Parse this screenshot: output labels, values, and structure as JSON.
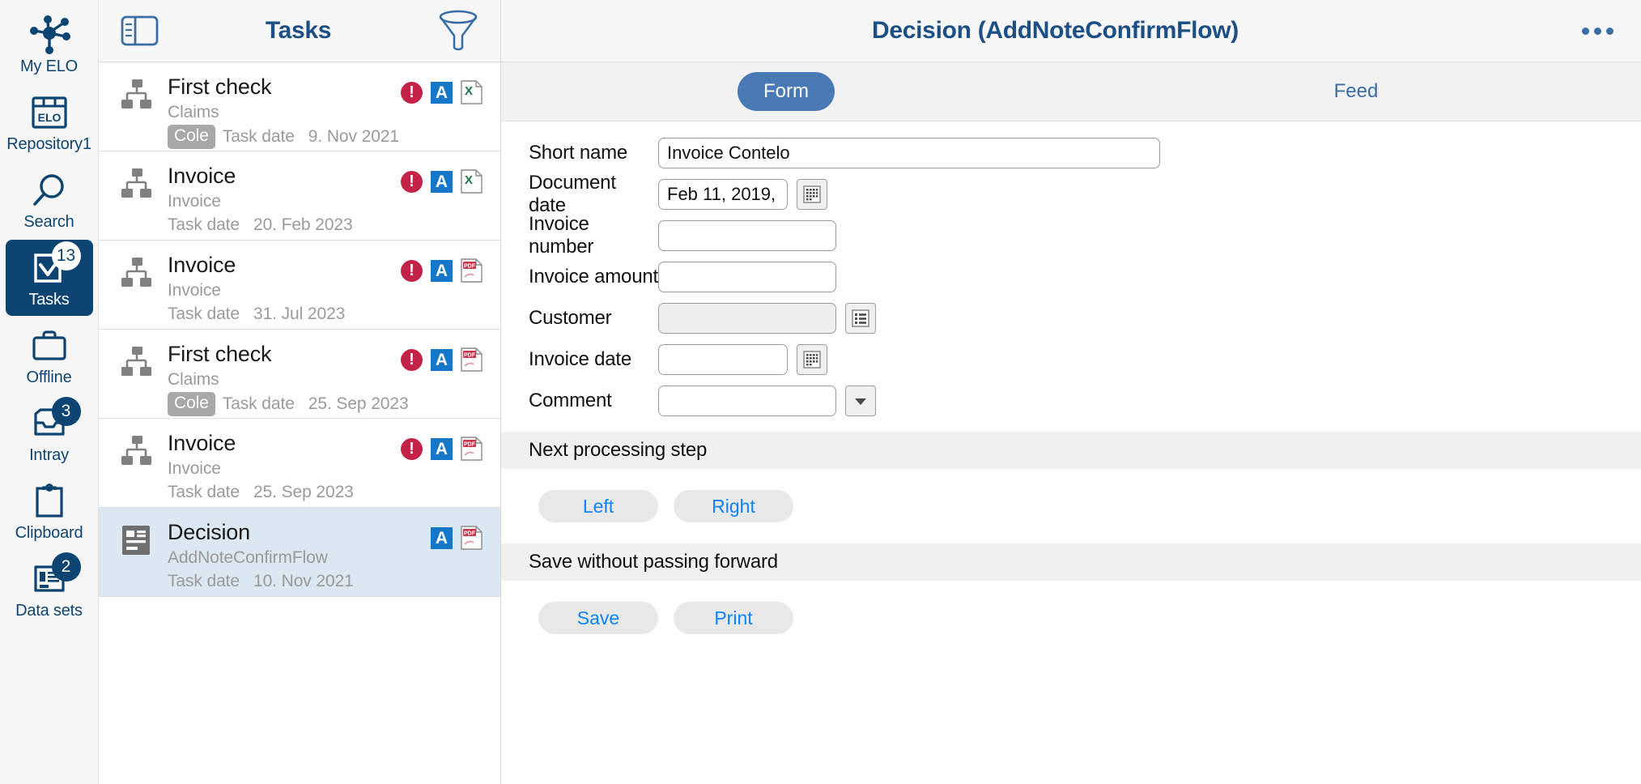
{
  "rail": {
    "items": [
      {
        "label": "My ELO",
        "icon": "network-hub-icon",
        "badge": null,
        "active": false
      },
      {
        "label": "Repository1",
        "icon": "repository-icon",
        "badge": null,
        "active": false
      },
      {
        "label": "Search",
        "icon": "search-icon",
        "badge": null,
        "active": false
      },
      {
        "label": "Tasks",
        "icon": "tasks-check-icon",
        "badge": "13",
        "active": true
      },
      {
        "label": "Offline",
        "icon": "briefcase-icon",
        "badge": null,
        "active": false
      },
      {
        "label": "Intray",
        "icon": "intray-icon",
        "badge": "3",
        "active": false
      },
      {
        "label": "Clipboard",
        "icon": "clipboard-icon",
        "badge": null,
        "active": false
      },
      {
        "label": "Data sets",
        "icon": "data-sets-icon",
        "badge": "2",
        "active": false
      }
    ]
  },
  "tasklist": {
    "title": "Tasks",
    "panel_toggle_icon": "panel-toggle-icon",
    "filter_icon": "filter-funnel-icon",
    "rows": [
      {
        "name": "First check",
        "subtitle": "Claims",
        "chip": "Cole",
        "date_label": "Task date",
        "date_value": "9. Nov 2021",
        "type_icon": "workflow-icon",
        "selected": false,
        "status_icons": [
          "alert-icon",
          "annotation-a-icon",
          "excel-file-icon"
        ]
      },
      {
        "name": "Invoice",
        "subtitle": "Invoice",
        "chip": null,
        "date_label": "Task date",
        "date_value": "20. Feb 2023",
        "type_icon": "workflow-icon",
        "selected": false,
        "status_icons": [
          "alert-icon",
          "annotation-a-icon",
          "excel-file-icon"
        ]
      },
      {
        "name": "Invoice",
        "subtitle": "Invoice",
        "chip": null,
        "date_label": "Task date",
        "date_value": "31. Jul 2023",
        "type_icon": "workflow-icon",
        "selected": false,
        "status_icons": [
          "alert-icon",
          "annotation-a-icon",
          "pdf-file-icon"
        ]
      },
      {
        "name": "First check",
        "subtitle": "Claims",
        "chip": "Cole",
        "date_label": "Task date",
        "date_value": "25. Sep 2023",
        "type_icon": "workflow-icon",
        "selected": false,
        "status_icons": [
          "alert-icon",
          "annotation-a-icon",
          "pdf-file-icon"
        ]
      },
      {
        "name": "Invoice",
        "subtitle": "Invoice",
        "chip": null,
        "date_label": "Task date",
        "date_value": "25. Sep 2023",
        "type_icon": "workflow-icon",
        "selected": false,
        "status_icons": [
          "alert-icon",
          "annotation-a-icon",
          "pdf-file-icon"
        ]
      },
      {
        "name": "Decision",
        "subtitle": "AddNoteConfirmFlow",
        "chip": null,
        "date_label": "Task date",
        "date_value": "10. Nov 2021",
        "type_icon": "form-icon",
        "selected": true,
        "status_icons": [
          "annotation-a-icon",
          "pdf-file-icon"
        ]
      }
    ]
  },
  "detail": {
    "title": "Decision (AddNoteConfirmFlow)",
    "overflow_icon": "more-options-icon",
    "tabs": [
      {
        "label": "Form",
        "active": true
      },
      {
        "label": "Feed",
        "active": false
      }
    ],
    "form_fields": [
      {
        "label": "Short name",
        "value": "Invoice Contelo",
        "width": "wide",
        "disabled": false,
        "button": null
      },
      {
        "label": "Document date",
        "value": "Feb 11, 2019, ",
        "width": "short",
        "disabled": false,
        "button": "calendar-icon"
      },
      {
        "label": "Invoice number",
        "value": "",
        "width": "med",
        "disabled": false,
        "button": null
      },
      {
        "label": "Invoice amount",
        "value": "",
        "width": "med",
        "disabled": false,
        "button": null
      },
      {
        "label": "Customer",
        "value": "",
        "width": "med",
        "disabled": true,
        "button": "list-picker-icon"
      },
      {
        "label": "Invoice date",
        "value": "",
        "width": "short",
        "disabled": false,
        "button": "calendar-icon"
      },
      {
        "label": "Comment",
        "value": "",
        "width": "med",
        "disabled": false,
        "button": "chevron-down-icon"
      }
    ],
    "sections": [
      {
        "heading": "Next processing step",
        "buttons": [
          "Left",
          "Right"
        ]
      },
      {
        "heading": "Save without passing forward",
        "buttons": [
          "Save",
          "Print"
        ]
      }
    ]
  },
  "colors": {
    "brand_navy": "#0d4472",
    "header_blue": "#1b4f86",
    "tab_blue": "#4a7ab5",
    "action_blue": "#0a84ff",
    "alert_red": "#c42348",
    "annotation_blue": "#1676c8",
    "excel_green": "#1f7346",
    "pdf_red": "#c8344a",
    "selected_row": "#dbe7f1",
    "chip_gray": "#a8a8a8"
  }
}
